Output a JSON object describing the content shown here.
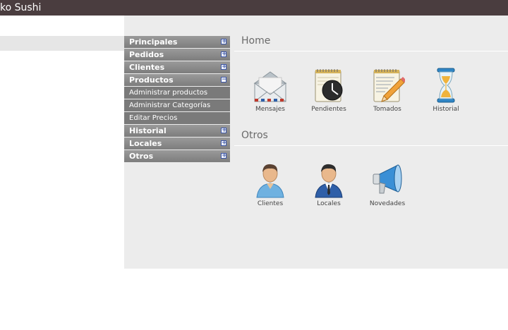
{
  "app": {
    "title": "ko Sushi"
  },
  "menu": {
    "principales": "Principales",
    "pedidos": "Pedidos",
    "clientes": "Clientes",
    "productos": "Productos",
    "productos_items": [
      "Administrar productos",
      "Administrar Categorías",
      "Editar Precios"
    ],
    "historial": "Historial",
    "locales": "Locales",
    "otros": "Otros",
    "collapsed_glyph": "+",
    "expanded_glyph": "−"
  },
  "home": {
    "title": "Home",
    "tiles": [
      {
        "label": "Mensajes",
        "icon": "envelope-icon"
      },
      {
        "label": "Pendientes",
        "icon": "clock-notepad-icon"
      },
      {
        "label": "Tomados",
        "icon": "notepad-pencil-icon"
      },
      {
        "label": "Historial",
        "icon": "hourglass-icon"
      }
    ]
  },
  "otros": {
    "title": "Otros",
    "tiles": [
      {
        "label": "Clientes",
        "icon": "person-icon"
      },
      {
        "label": "Locales",
        "icon": "business-person-icon"
      },
      {
        "label": "Novedades",
        "icon": "megaphone-icon"
      }
    ]
  }
}
